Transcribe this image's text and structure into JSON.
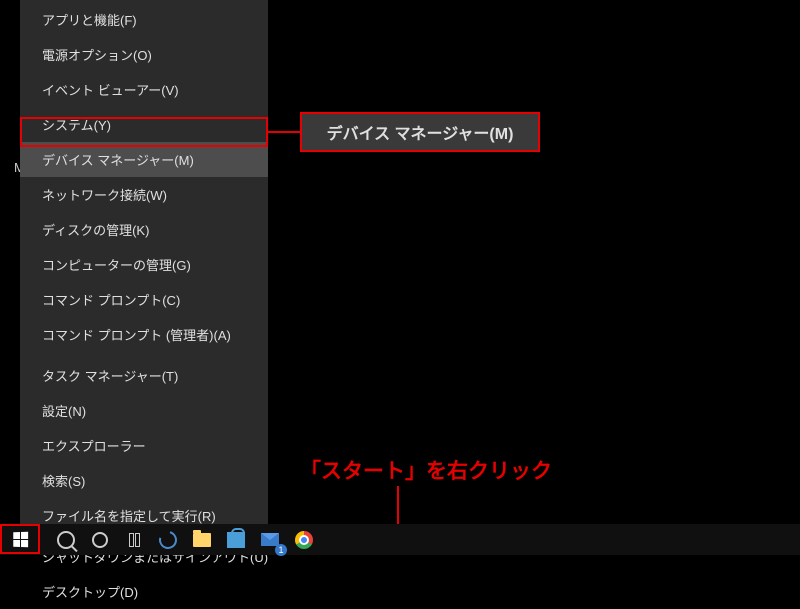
{
  "desktop_partial_label": "M",
  "menu": {
    "items": [
      {
        "label": "アプリと機能(F)"
      },
      {
        "label": "電源オプション(O)"
      },
      {
        "label": "イベント ビューアー(V)"
      },
      {
        "label": "システム(Y)"
      },
      {
        "label": "デバイス マネージャー(M)",
        "highlighted": true
      },
      {
        "label": "ネットワーク接続(W)"
      },
      {
        "label": "ディスクの管理(K)"
      },
      {
        "label": "コンピューターの管理(G)"
      },
      {
        "label": "コマンド プロンプト(C)"
      },
      {
        "label": "コマンド プロンプト (管理者)(A)"
      }
    ],
    "items2": [
      {
        "label": "タスク マネージャー(T)"
      },
      {
        "label": "設定(N)"
      },
      {
        "label": "エクスプローラー"
      },
      {
        "label": "検索(S)"
      },
      {
        "label": "ファイル名を指定して実行(R)"
      }
    ],
    "items3": [
      {
        "label": "シャットダウンまたはサインアウト(U)"
      },
      {
        "label": "デスクトップ(D)"
      }
    ]
  },
  "callout": {
    "text": "デバイス マネージャー(M)"
  },
  "annotation": {
    "text": "「スタート」を右クリック"
  },
  "taskbar": {
    "mail_badge": "1"
  }
}
